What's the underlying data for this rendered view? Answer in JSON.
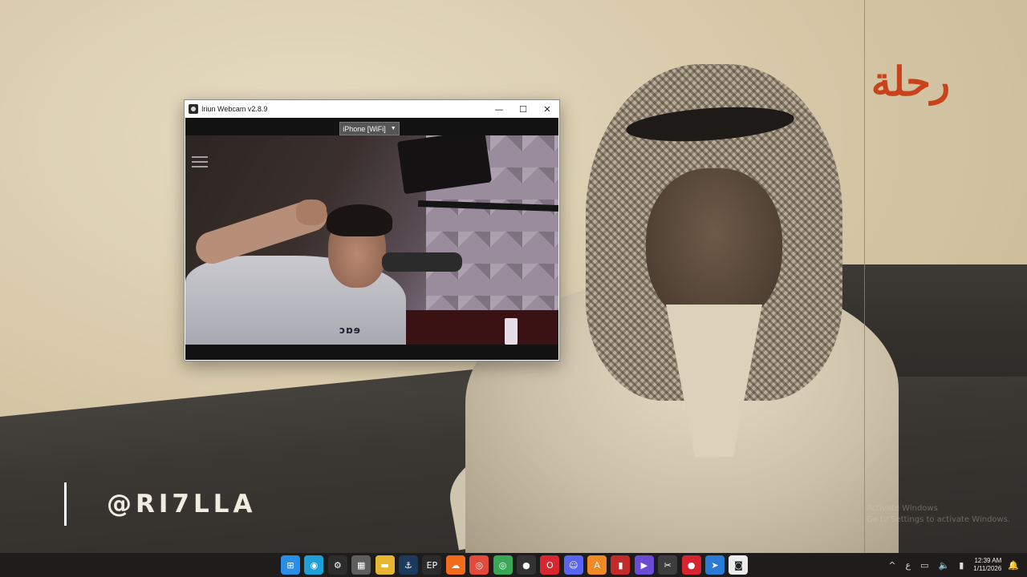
{
  "desktop": {
    "wallpaper_logo": "رحلة",
    "handle": "@RI7LLA",
    "faint_text": [
      "Activate Windows",
      "Go to Settings to activate Windows."
    ]
  },
  "window": {
    "title": "Iriun Webcam v2.8.9",
    "controls": {
      "minimize": "—",
      "maximize": "☐",
      "close": "✕"
    },
    "device_select": {
      "selected": "iPhone [WiFi]"
    },
    "hoodie_print": "ɔɒɘ"
  },
  "taskbar": {
    "apps": [
      {
        "name": "windows-start",
        "glyph": "⊞",
        "color": "#2b8ee6"
      },
      {
        "name": "edge",
        "glyph": "◉",
        "color": "#1e9fd8"
      },
      {
        "name": "obs",
        "glyph": "⚙",
        "color": "#2c2c2c"
      },
      {
        "name": "store",
        "glyph": "▦",
        "color": "#5e5e5e"
      },
      {
        "name": "file-explorer",
        "glyph": "▬",
        "color": "#e8b730"
      },
      {
        "name": "steam",
        "glyph": "⚓",
        "color": "#1b3a5c"
      },
      {
        "name": "epic-games",
        "glyph": "EP",
        "color": "#2b2b2b"
      },
      {
        "name": "soundcloud",
        "glyph": "☁",
        "color": "#f26a1b"
      },
      {
        "name": "chrome",
        "glyph": "◎",
        "color": "#e24b3b"
      },
      {
        "name": "chrome-alt",
        "glyph": "◎",
        "color": "#3aa757"
      },
      {
        "name": "github",
        "glyph": "●",
        "color": "#333333"
      },
      {
        "name": "opera",
        "glyph": "O",
        "color": "#d7262e"
      },
      {
        "name": "discord",
        "glyph": "☺",
        "color": "#5865f2"
      },
      {
        "name": "app-orange",
        "glyph": "A",
        "color": "#f08a24"
      },
      {
        "name": "app-red",
        "glyph": "▮",
        "color": "#c32b2b"
      },
      {
        "name": "app-purple",
        "glyph": "▶",
        "color": "#6a4bd6"
      },
      {
        "name": "app-tool",
        "glyph": "✂",
        "color": "#3d3d3d"
      },
      {
        "name": "app-rec",
        "glyph": "●",
        "color": "#d6252e"
      },
      {
        "name": "app-blue",
        "glyph": "➤",
        "color": "#2a7bd6"
      },
      {
        "name": "iriun",
        "glyph": "◙",
        "color": "#ececec"
      }
    ],
    "tray": {
      "chevron": "^",
      "lang": "ع",
      "net": "▭",
      "volume": "🔈",
      "battery": "▮"
    },
    "time": "12:39 AM",
    "date": "1/11/2026",
    "notification": "🔔"
  }
}
